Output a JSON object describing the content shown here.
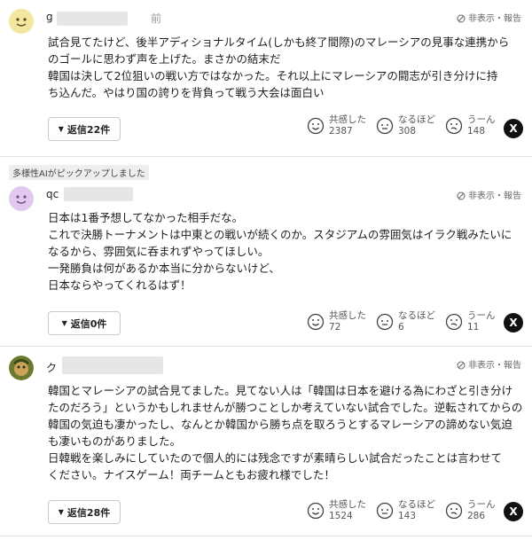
{
  "ui": {
    "hide_report": "非表示・報告",
    "labels": {
      "kyokan": "共感した",
      "naruhodo": "なるほど",
      "uun": "うーん"
    },
    "x_label": "X",
    "reply_prefix": "返信"
  },
  "pickup_label": "多様性AIがピックアップしました",
  "comments": [
    {
      "user_fragment": "g",
      "user_suffix": "前",
      "avatar_color": "#f2e6a0",
      "text_lines": [
        "試合見てたけど、後半アディショナルタイム(しかも終了間際)のマレーシアの見事な連携から",
        "のゴールに思わず声を上げた。まさかの結末だ",
        "韓国は決して2位狙いの戦い方ではなかった。それ以上にマレーシアの闘志が引き分けに持",
        "ち込んだ。やはり国の誇りを背負って戦う大会は面白い"
      ],
      "reply_label": "返信22件",
      "counts": {
        "kyokan": "2387",
        "naruhodo": "308",
        "uun": "148"
      }
    },
    {
      "user_fragment": "qc",
      "avatar_color": "#e2c9ef",
      "text_lines": [
        "日本は1番予想してなかった相手だな。",
        "これで決勝トーナメントは中東との戦いが続くのか。スタジアムの雰囲気はイラク戦みたいに",
        "なるから、雰囲気に呑まれずやってほしい。",
        "一発勝負は何があるか本当に分からないけど、",
        "日本ならやってくれるはず！"
      ],
      "reply_label": "返信0件",
      "counts": {
        "kyokan": "72",
        "naruhodo": "6",
        "uun": "11"
      }
    },
    {
      "user_fragment": "ク",
      "avatar_color": "#6b7a2f",
      "text_lines": [
        "韓国とマレーシアの試合見てました。見てない人は「韓国は日本を避ける為にわざと引き分け",
        "たのだろう」というかもしれませんが勝つことしか考えていない試合でした。逆転されてからの",
        "韓国の気迫も凄かったし、なんとか韓国から勝ち点を取ろうとするマレーシアの諦めない気迫",
        "も凄いものがありました。",
        "日韓戦を楽しみにしていたので個人的には残念ですが素晴らしい試合だったことは言わせて",
        "ください。ナイスゲーム！両チームともお疲れ様でした！"
      ],
      "reply_label": "返信28件",
      "counts": {
        "kyokan": "1524",
        "naruhodo": "143",
        "uun": "286"
      }
    }
  ]
}
